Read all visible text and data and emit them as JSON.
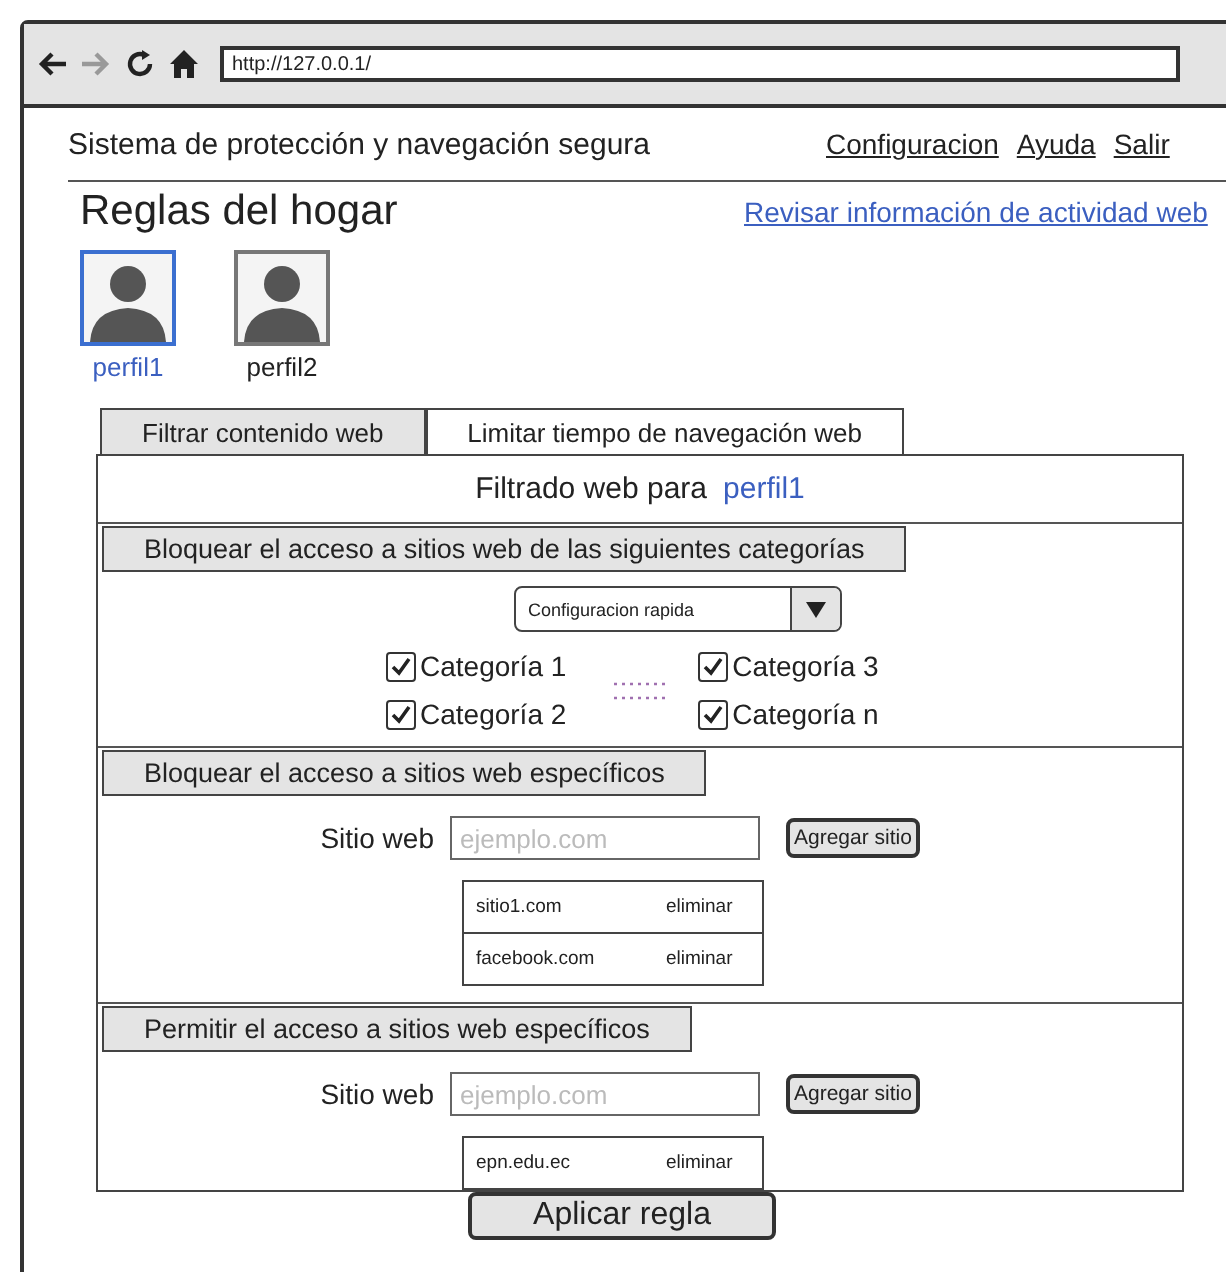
{
  "browser": {
    "address": "http://127.0.0.1/"
  },
  "header": {
    "title": "Sistema de protección y navegación segura",
    "links": [
      "Configuracion",
      "Ayuda",
      "Salir"
    ]
  },
  "page_title": "Reglas del hogar",
  "activity_link": "Revisar información de actividad web",
  "profiles": [
    {
      "name": "perfil1",
      "selected": true
    },
    {
      "name": "perfil2",
      "selected": false
    }
  ],
  "tabs": [
    {
      "label": "Filtrar contenido web",
      "selected": true
    },
    {
      "label": "Limitar tiempo de navegación web",
      "selected": false
    }
  ],
  "filter_heading": {
    "label": "Filtrado web para",
    "profile": "perfil1"
  },
  "sections": [
    {
      "kind": "categories",
      "heading": "Bloquear el acceso a sitios web de las siguientes categorías",
      "dropdown": "Configuracion rapida",
      "categories": [
        {
          "label": "Categoría 1",
          "checked": true
        },
        {
          "label": "Categoría 2",
          "checked": true
        },
        {
          "label": "Categoría 3",
          "checked": true
        },
        {
          "label": "Categoría n",
          "checked": true
        }
      ]
    },
    {
      "kind": "sites",
      "heading": "Bloquear el acceso a sitios web específicos",
      "field_label": "Sitio web",
      "placeholder": "ejemplo.com",
      "button": "Agregar sitio",
      "sites": [
        {
          "site": "sitio1.com",
          "action": "eliminar"
        },
        {
          "site": "facebook.com",
          "action": "eliminar"
        }
      ]
    },
    {
      "kind": "sites",
      "heading": "Permitir el acceso a sitios web específicos",
      "field_label": "Sitio web",
      "placeholder": "ejemplo.com",
      "button": "Agregar sitio",
      "sites": [
        {
          "site": "epn.edu.ec",
          "action": "eliminar"
        }
      ]
    }
  ],
  "apply_button": "Aplicar regla"
}
